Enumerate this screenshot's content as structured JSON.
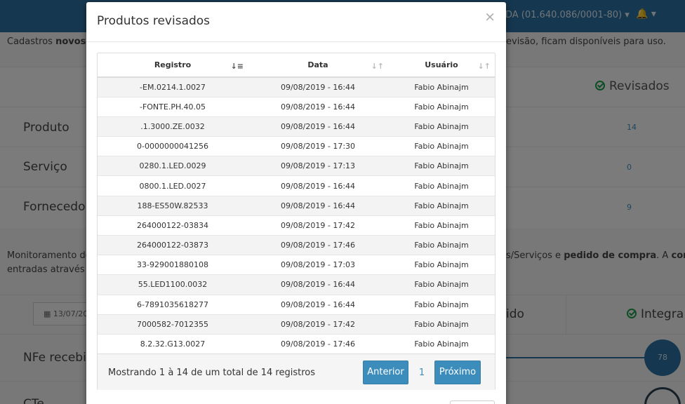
{
  "background": {
    "company_label": "DA (01.640.086/0001-80) ▾",
    "bell_label": "🔔 ▾",
    "intro_text_left": "Cadastros",
    "intro_text_bold": "novos",
    "intro_text_right": "evisão, ficam disponíveis para uso.",
    "revisados_label": "Revisados",
    "rows": [
      {
        "label": "Produto",
        "count": "14"
      },
      {
        "label": "Serviço",
        "count": "0"
      },
      {
        "label": "Fornecedor",
        "count": "9"
      }
    ],
    "monitor_left": "Monitoramento de",
    "monitor_left2": "entradas através da",
    "monitor_right_a": "s/Serviços e",
    "monitor_right_bold": "pedido de compra",
    "monitor_right_b": ". A",
    "monitor_right_bold2": "conversã",
    "date_value": "13/07/20",
    "tab_ido": "ido",
    "tab_integra": "Integra",
    "nfe_label": "NFe recebid",
    "cte_label": "CTe",
    "circle_value": "78"
  },
  "modal": {
    "title": "Produtos revisados",
    "close_symbol": "×",
    "columns": [
      "Registro",
      "Data",
      "Usuário"
    ],
    "rows": [
      [
        "-EM.0214.1.0027",
        "09/08/2019 - 16:44",
        "Fabio Abinajm"
      ],
      [
        "-FONTE.PH.40.05",
        "09/08/2019 - 16:44",
        "Fabio Abinajm"
      ],
      [
        ".1.3000.ZE.0032",
        "09/08/2019 - 16:44",
        "Fabio Abinajm"
      ],
      [
        "0-0000000041256",
        "09/08/2019 - 17:30",
        "Fabio Abinajm"
      ],
      [
        "0280.1.LED.0029",
        "09/08/2019 - 17:13",
        "Fabio Abinajm"
      ],
      [
        "0800.1.LED.0027",
        "09/08/2019 - 16:44",
        "Fabio Abinajm"
      ],
      [
        "188-ES50W.82533",
        "09/08/2019 - 16:44",
        "Fabio Abinajm"
      ],
      [
        "264000122-03834",
        "09/08/2019 - 17:42",
        "Fabio Abinajm"
      ],
      [
        "264000122-03873",
        "09/08/2019 - 17:46",
        "Fabio Abinajm"
      ],
      [
        "33-929001880108",
        "09/08/2019 - 17:03",
        "Fabio Abinajm"
      ],
      [
        "55.LED1100.0032",
        "09/08/2019 - 16:44",
        "Fabio Abinajm"
      ],
      [
        "6-7891035618277",
        "09/08/2019 - 16:44",
        "Fabio Abinajm"
      ],
      [
        "7000582-7012355",
        "09/08/2019 - 17:42",
        "Fabio Abinajm"
      ],
      [
        "8.2.32.G13.0027",
        "09/08/2019 - 17:46",
        "Fabio Abinajm"
      ]
    ],
    "info": "Mostrando 1 à 14 de um total de 14 registros",
    "prev_label": "Anterior",
    "page": "1",
    "next_label": "Próximo"
  },
  "colors": {
    "accent": "#3c8dbc",
    "topbar": "#2b6e9e",
    "success": "#1c9a4a"
  }
}
